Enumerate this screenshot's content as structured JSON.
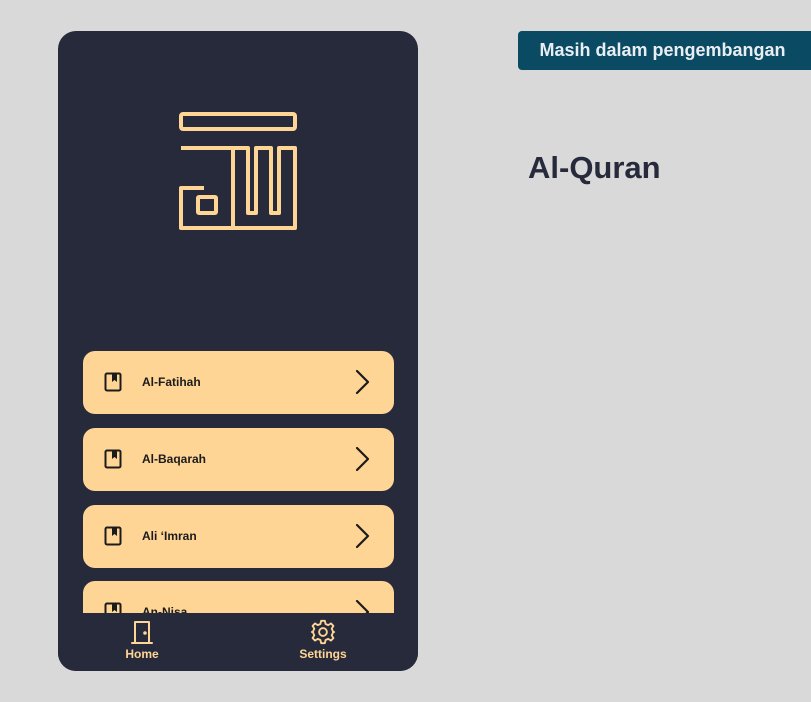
{
  "banner": {
    "text": "Masih dalam pengembangan"
  },
  "page": {
    "title": "Al-Quran"
  },
  "surahs": [
    {
      "name": "Al-Fatihah"
    },
    {
      "name": "Al-Baqarah"
    },
    {
      "name": "Ali ‘Imran"
    },
    {
      "name": "An-Nisa"
    }
  ],
  "nav": {
    "home_label": "Home",
    "settings_label": "Settings"
  },
  "colors": {
    "background": "#d9d9d9",
    "phone_bg": "#272a3b",
    "accent": "#ffd596",
    "banner_bg": "#0b4a63"
  },
  "icons": {
    "logo": "allah-calligraphy-icon",
    "item": "book-icon",
    "arrow": "chevron-right-icon",
    "home": "door-icon",
    "settings": "gear-icon"
  }
}
